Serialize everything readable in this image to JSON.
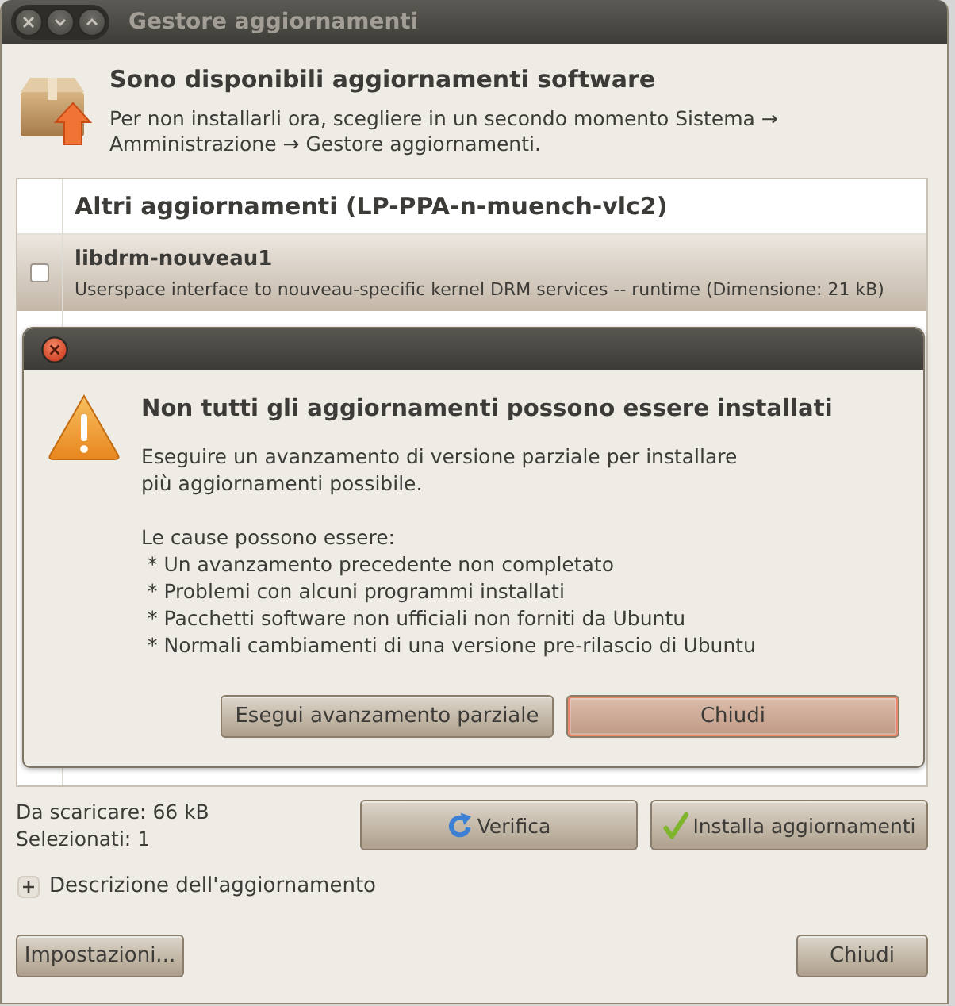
{
  "window": {
    "title": "Gestore aggiornamenti"
  },
  "header": {
    "title": "Sono disponibili aggiornamenti software",
    "text": "Per non installarli ora, scegliere in un secondo momento Sistema → Amministrazione → Gestore aggiornamenti."
  },
  "updates": {
    "group": "Altri aggiornamenti (LP-PPA-n-muench-vlc2)",
    "rows": [
      {
        "name": "libdrm-nouveau1",
        "description": "Userspace interface to nouveau-specific kernel DRM services -- runtime (Dimensione: 21 kB)",
        "checked": false,
        "selected": true
      }
    ]
  },
  "summary": {
    "download": "Da scaricare: 66 kB",
    "selected_count": "Selezionati: 1"
  },
  "actions": {
    "verify": {
      "label": "Verifica"
    },
    "install": {
      "label": "Installa aggiornamenti"
    }
  },
  "expander": {
    "label": "Descrizione dell'aggiornamento",
    "expanded": false
  },
  "footer_buttons": [
    {
      "label": "Impostazioni..."
    },
    {
      "label": "Chiudi"
    }
  ],
  "dialog": {
    "title": "Non tutti gli aggiornamenti possono essere installati",
    "message": "Eseguire un avanzamento di versione parziale per installare\npiù aggiornamenti possibile.",
    "causes_intro": "Le cause possono essere:",
    "causes": [
      "* Un avanzamento precedente non completato",
      "* Problemi con alcuni programmi installati",
      "* Pacchetti software non ufficiali non forniti da Ubuntu",
      "* Normali cambiamenti di una versione pre-rilascio di Ubuntu"
    ],
    "buttons": [
      {
        "label": "Esegui avanzamento parziale",
        "focused": false
      },
      {
        "label": "Chiudi",
        "focused": true
      }
    ]
  }
}
